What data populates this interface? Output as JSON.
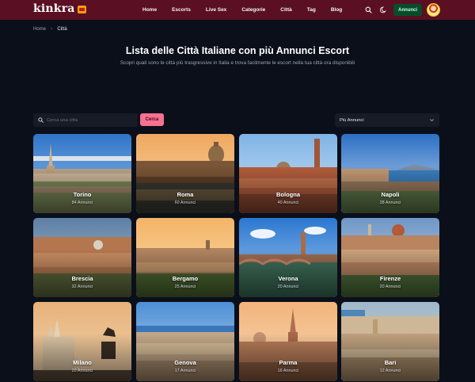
{
  "header": {
    "logo": "kinkra",
    "nav": [
      "Home",
      "Escorts",
      "Live Sex",
      "Categorie",
      "Città",
      "Tag",
      "Blog"
    ],
    "annunci_button": "Annunci",
    "icons": [
      "search-icon",
      "moon-icon",
      "avatar"
    ]
  },
  "breadcrumb": {
    "home": "Home",
    "separator": "›",
    "current": "Città"
  },
  "hero": {
    "title": "Lista delle Città Italiane con più Annunci Escort",
    "subtitle": "Scopri quali sono le città più trasgressive in Italia e trova facilmente le escort nella tua città ora disponibili"
  },
  "search": {
    "placeholder": "Cerca una città",
    "button": "Cerca"
  },
  "sort": {
    "selected": "Più Annunci"
  },
  "cities": [
    {
      "name": "Torino",
      "count": "84 Annunci"
    },
    {
      "name": "Roma",
      "count": "60 Annunci"
    },
    {
      "name": "Bologna",
      "count": "40 Annunci"
    },
    {
      "name": "Napoli",
      "count": "38 Annunci"
    },
    {
      "name": "Brescia",
      "count": "32 Annunci"
    },
    {
      "name": "Bergamo",
      "count": "25 Annunci"
    },
    {
      "name": "Verona",
      "count": "20 Annunci"
    },
    {
      "name": "Firenze",
      "count": "20 Annunci"
    },
    {
      "name": "Milano",
      "count": "20 Annunci"
    },
    {
      "name": "Genova",
      "count": "17 Annunci"
    },
    {
      "name": "Parma",
      "count": "16 Annunci"
    },
    {
      "name": "Bari",
      "count": "12 Annunci"
    }
  ],
  "colors": {
    "header_bg": "#5a1022",
    "page_bg": "#0b0f1a",
    "accent_pink": "#f87191",
    "annunci_green": "#064e2b"
  }
}
